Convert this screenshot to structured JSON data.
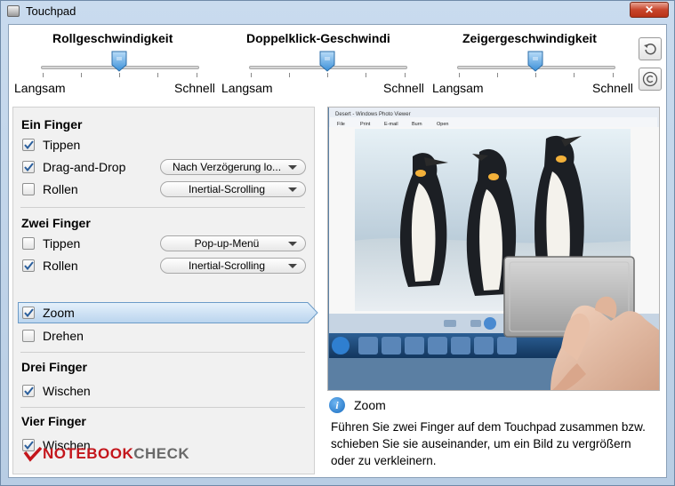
{
  "window": {
    "title": "Touchpad",
    "close_label": "✕"
  },
  "sliders": [
    {
      "title": "Rollgeschwindigkeit",
      "min_label": "Langsam",
      "max_label": "Schnell",
      "value": 0.5
    },
    {
      "title": "Doppelklick-Geschwindi",
      "min_label": "Langsam",
      "max_label": "Schnell",
      "value": 0.5
    },
    {
      "title": "Zeigergeschwindigkeit",
      "min_label": "Langsam",
      "max_label": "Schnell",
      "value": 0.5
    }
  ],
  "side_buttons": {
    "reset_icon": "reset-icon",
    "copyright_icon": "copyright-icon"
  },
  "sections": {
    "one_finger": {
      "header": "Ein Finger",
      "tap": {
        "label": "Tippen",
        "checked": true
      },
      "drag": {
        "label": "Drag-and-Drop",
        "checked": true,
        "option": "Nach Verzögerung lo..."
      },
      "scroll": {
        "label": "Rollen",
        "checked": false,
        "option": "Inertial-Scrolling"
      }
    },
    "two_finger": {
      "header": "Zwei Finger",
      "tap": {
        "label": "Tippen",
        "checked": false,
        "option": "Pop-up-Menü"
      },
      "scroll": {
        "label": "Rollen",
        "checked": true,
        "option": "Inertial-Scrolling"
      },
      "zoom": {
        "label": "Zoom",
        "checked": true
      },
      "rotate": {
        "label": "Drehen",
        "checked": false
      }
    },
    "three_finger": {
      "header": "Drei Finger",
      "swipe": {
        "label": "Wischen",
        "checked": true
      }
    },
    "four_finger": {
      "header": "Vier Finger",
      "swipe": {
        "label": "Wischen",
        "checked": true
      }
    }
  },
  "logo": {
    "part1": "NOTEBOOK",
    "part2": "CHECK"
  },
  "preview": {
    "viewer_title": "Desert - Windows Photo Viewer",
    "menu": [
      "File",
      "Print",
      "E-mail",
      "Burn",
      "Open"
    ]
  },
  "info": {
    "title": "Zoom",
    "description": "Führen Sie zwei Finger auf dem Touchpad zusammen bzw. schieben Sie sie auseinander, um ein Bild zu vergrößern oder zu verkleinern."
  },
  "colors": {
    "accent": "#3d8fd6",
    "selection": "#cfe1f3",
    "titlebar": "#c9dbee"
  }
}
